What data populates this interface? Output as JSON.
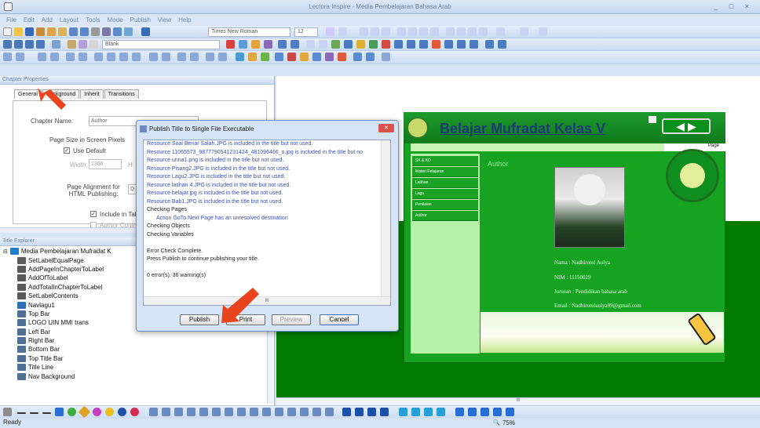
{
  "window": {
    "title": "Lectora Inspire - Media Pembelajaran Bahasa Arab",
    "controls": "_ □ ×"
  },
  "menu": [
    "File",
    "Edit",
    "Add",
    "Layout",
    "Tools",
    "Mode",
    "Publish",
    "View",
    "Help"
  ],
  "toolbar": {
    "font": "Times New Roman",
    "size": "12",
    "style": "Blank"
  },
  "chapter_panel": {
    "title": "Chapter Properties",
    "tabs": [
      "General",
      "Background",
      "Inherit",
      "Transitions"
    ],
    "chapter_name_label": "Chapter Name:",
    "chapter_name_value": "Author",
    "page_size_label": "Page Size in Screen Pixels",
    "use_default": "Use Default",
    "width_label": "Width:",
    "width_value": "1366",
    "height_label": "H",
    "alignment_label": "Page Alignment for HTML Publishing:",
    "alignment_value": "D",
    "include_label": "Include in Tab",
    "author_control": "Author Control"
  },
  "explorer": {
    "title": "Title Explorer",
    "items": [
      {
        "label": "Media Pembelajaran Mufradat K",
        "color": "#1c7fd0"
      },
      {
        "label": "SetLabelEqualPage",
        "color": "#5a5a5a"
      },
      {
        "label": "AddPageInChapterToLabel",
        "color": "#5a5a5a"
      },
      {
        "label": "AddOfToLabel",
        "color": "#5a5a5a"
      },
      {
        "label": "AddTotalInChapterToLabel",
        "color": "#5a5a5a"
      },
      {
        "label": "SetLabelContents",
        "color": "#5a5a5a"
      },
      {
        "label": "Navlagu1",
        "color": "#2e6fb7"
      },
      {
        "label": "Top Bar",
        "color": "#4f6f95"
      },
      {
        "label": "LOGO UIN MMI trans",
        "color": "#4f6f95"
      },
      {
        "label": "Left Bar",
        "color": "#4f6f95"
      },
      {
        "label": "Right Bar",
        "color": "#4f6f95"
      },
      {
        "label": "Bottom Bar",
        "color": "#4f6f95"
      },
      {
        "label": "Top Title Bar",
        "color": "#4f6f95"
      },
      {
        "label": "Title Line",
        "color": "#4f6f95"
      },
      {
        "label": "Nav Background",
        "color": "#4f6f95"
      }
    ]
  },
  "dialog": {
    "title": "Publish Title to Single File Executable",
    "lines": [
      {
        "text": "Resource Soal Benar Salah.JPG is included in the title but not used.",
        "color": "#3a4fb5"
      },
      {
        "text": "Resource 11065573_987779054123142​4_481096466_o.jpg is included in the title but no",
        "color": "#3a4fb5"
      },
      {
        "text": "Resource unna1.png is included in the title but not used.",
        "color": "#3a4fb5"
      },
      {
        "text": "Resource Pisang2.JPG is included in the title but not used.",
        "color": "#3a4fb5"
      },
      {
        "text": "Resource Lagu2.JPG is included in the title but not used.",
        "color": "#3a4fb5"
      },
      {
        "text": "Resource latihan 4.JPG is included in the title but not used.",
        "color": "#3a4fb5"
      },
      {
        "text": "Resource belajar.jpg is included in the title but not used.",
        "color": "#3a4fb5"
      },
      {
        "text": "Resource Bab1.JPG is included in the title but not used.",
        "color": "#3a4fb5"
      },
      {
        "text": "Checking Pages",
        "color": "#222"
      },
      {
        "text": "      Action GoTo Next Page has an unresolved destination",
        "color": "#3a4fb5"
      },
      {
        "text": "Checking Objects",
        "color": "#222"
      },
      {
        "text": "Checking Variables",
        "color": "#222"
      },
      {
        "text": "",
        "color": "#222"
      },
      {
        "text": "Error Check Complete.",
        "color": "#222"
      },
      {
        "text": "Press Publish to continue publishing your title.",
        "color": "#222"
      },
      {
        "text": "",
        "color": "#222"
      },
      {
        "text": "0 error(s), 36 warning(s)",
        "color": "#222"
      }
    ],
    "publish": "Publish",
    "print": "Print",
    "preview": "Preview",
    "cancel": "Cancel",
    "scroll_mark": "III"
  },
  "page": {
    "title": "Belajar Mufradat Kelas V",
    "page_label": "Page",
    "author_heading": "Author",
    "nav": [
      "SK & KD",
      "Materi Pelajaran",
      "Latihan",
      "Lagu",
      "Penilaian",
      "Author"
    ],
    "info": [
      "Nama   : Nadhirotul Aulya",
      "NIM   : 11150029",
      "Jurusan   : Pendidikan bahasa arab",
      "Email   : Nadhirotulaulya99@gmail.com"
    ]
  },
  "canvas_scroll": "III",
  "status": {
    "text": "Ready",
    "zoom": "75%"
  },
  "colors": {
    "green": "#007b00",
    "accent": "#e8451f"
  }
}
